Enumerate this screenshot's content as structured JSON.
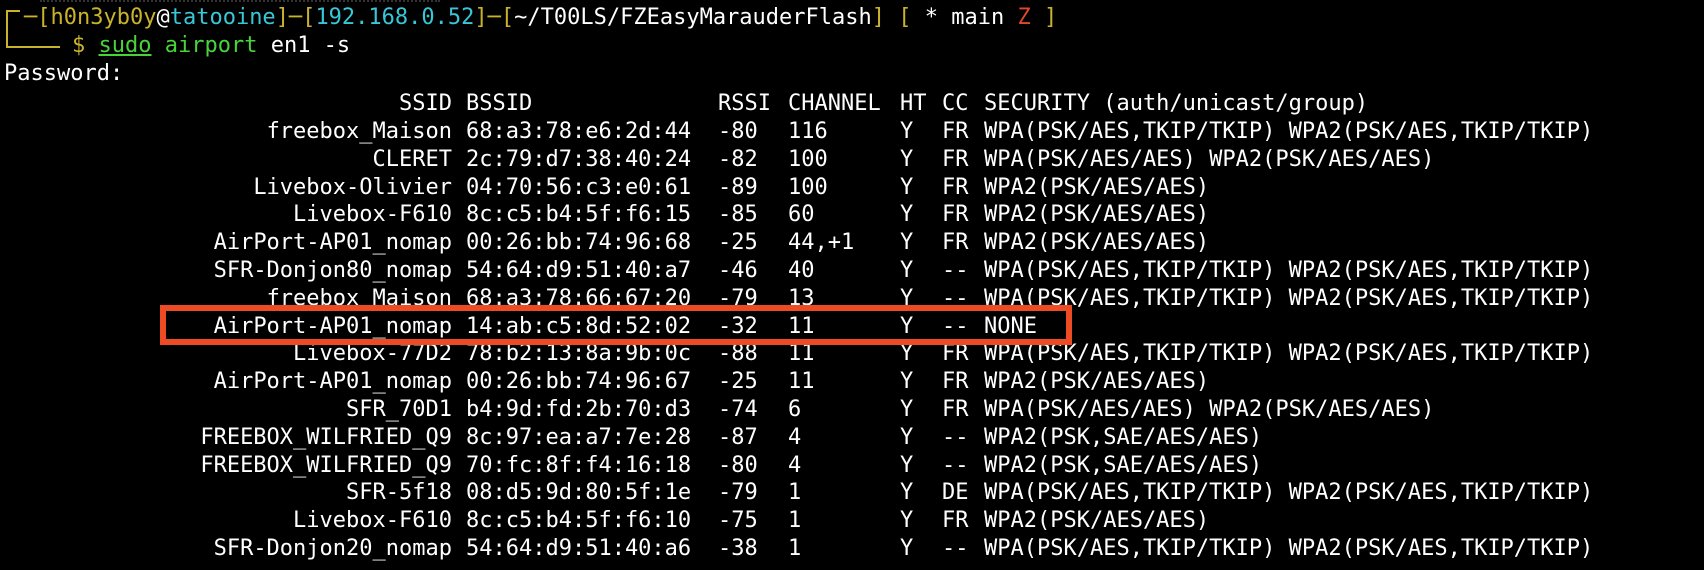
{
  "prompt": {
    "user": "h0n3yb0y",
    "at": "@",
    "host": "tatooine",
    "ip": "192.168.0.52",
    "path": "~/T00LS/FZEasyMarauderFlash",
    "git_open": "[",
    "git_star": "*",
    "git_branch": "main",
    "git_z": "Z",
    "git_close": "]",
    "symbol": "$",
    "command_sudo": "sudo",
    "command_airport": "airport",
    "command_args": "en1 -s"
  },
  "password_label": "Password:",
  "table": {
    "headers": {
      "ssid": "SSID",
      "bssid": "BSSID",
      "rssi": "RSSI",
      "channel": "CHANNEL",
      "ht": "HT",
      "cc": "CC",
      "security": "SECURITY (auth/unicast/group)"
    },
    "rows": [
      {
        "ssid": "freebox_Maison",
        "bssid": "68:a3:78:e6:2d:44",
        "rssi": "-80",
        "channel": "116",
        "ht": "Y",
        "cc": "FR",
        "security": "WPA(PSK/AES,TKIP/TKIP) WPA2(PSK/AES,TKIP/TKIP)"
      },
      {
        "ssid": "CLERET",
        "bssid": "2c:79:d7:38:40:24",
        "rssi": "-82",
        "channel": "100",
        "ht": "Y",
        "cc": "FR",
        "security": "WPA(PSK/AES/AES) WPA2(PSK/AES/AES)"
      },
      {
        "ssid": "Livebox-Olivier",
        "bssid": "04:70:56:c3:e0:61",
        "rssi": "-89",
        "channel": "100",
        "ht": "Y",
        "cc": "FR",
        "security": "WPA2(PSK/AES/AES)"
      },
      {
        "ssid": "Livebox-F610",
        "bssid": "8c:c5:b4:5f:f6:15",
        "rssi": "-85",
        "channel": "60",
        "ht": "Y",
        "cc": "FR",
        "security": "WPA2(PSK/AES/AES)"
      },
      {
        "ssid": "AirPort-AP01_nomap",
        "bssid": "00:26:bb:74:96:68",
        "rssi": "-25",
        "channel": "44,+1",
        "ht": "Y",
        "cc": "FR",
        "security": "WPA2(PSK/AES/AES)"
      },
      {
        "ssid": "SFR-Donjon80_nomap",
        "bssid": "54:64:d9:51:40:a7",
        "rssi": "-46",
        "channel": "40",
        "ht": "Y",
        "cc": "--",
        "security": "WPA(PSK/AES,TKIP/TKIP) WPA2(PSK/AES,TKIP/TKIP)"
      },
      {
        "ssid": "freebox_Maison",
        "bssid": "68:a3:78:66:67:20",
        "rssi": "-79",
        "channel": "13",
        "ht": "Y",
        "cc": "--",
        "security": "WPA(PSK/AES,TKIP/TKIP) WPA2(PSK/AES,TKIP/TKIP)"
      },
      {
        "ssid": "AirPort-AP01_nomap",
        "bssid": "14:ab:c5:8d:52:02",
        "rssi": "-32",
        "channel": "11",
        "ht": "Y",
        "cc": "--",
        "security": "NONE"
      },
      {
        "ssid": "Livebox-77D2",
        "bssid": "78:b2:13:8a:9b:0c",
        "rssi": "-88",
        "channel": "11",
        "ht": "Y",
        "cc": "FR",
        "security": "WPA(PSK/AES,TKIP/TKIP) WPA2(PSK/AES,TKIP/TKIP)"
      },
      {
        "ssid": "AirPort-AP01_nomap",
        "bssid": "00:26:bb:74:96:67",
        "rssi": "-25",
        "channel": "11",
        "ht": "Y",
        "cc": "FR",
        "security": "WPA2(PSK/AES/AES)"
      },
      {
        "ssid": "SFR_70D1",
        "bssid": "b4:9d:fd:2b:70:d3",
        "rssi": "-74",
        "channel": "6",
        "ht": "Y",
        "cc": "FR",
        "security": "WPA(PSK/AES/AES) WPA2(PSK/AES/AES)"
      },
      {
        "ssid": "FREEBOX_WILFRIED_Q9",
        "bssid": "8c:97:ea:a7:7e:28",
        "rssi": "-87",
        "channel": "4",
        "ht": "Y",
        "cc": "--",
        "security": "WPA2(PSK,SAE/AES/AES)"
      },
      {
        "ssid": "FREEBOX_WILFRIED_Q9",
        "bssid": "70:fc:8f:f4:16:18",
        "rssi": "-80",
        "channel": "4",
        "ht": "Y",
        "cc": "--",
        "security": "WPA2(PSK,SAE/AES/AES)"
      },
      {
        "ssid": "SFR-5f18",
        "bssid": "08:d5:9d:80:5f:1e",
        "rssi": "-79",
        "channel": "1",
        "ht": "Y",
        "cc": "DE",
        "security": "WPA(PSK/AES,TKIP/TKIP) WPA2(PSK/AES,TKIP/TKIP)"
      },
      {
        "ssid": "Livebox-F610",
        "bssid": "8c:c5:b4:5f:f6:10",
        "rssi": "-75",
        "channel": "1",
        "ht": "Y",
        "cc": "FR",
        "security": "WPA2(PSK/AES/AES)"
      },
      {
        "ssid": "SFR-Donjon20_nomap",
        "bssid": "54:64:d9:51:40:a6",
        "rssi": "-38",
        "channel": "1",
        "ht": "Y",
        "cc": "--",
        "security": "WPA(PSK/AES,TKIP/TKIP) WPA2(PSK/AES,TKIP/TKIP)"
      }
    ]
  },
  "colors": {
    "background": "#000000",
    "text": "#ffffff",
    "prompt_bracket": "#c9b32a",
    "user": "#c9b32a",
    "host": "#38c7d6",
    "command": "#49d33b",
    "highlight_box": "#ec4b24"
  }
}
